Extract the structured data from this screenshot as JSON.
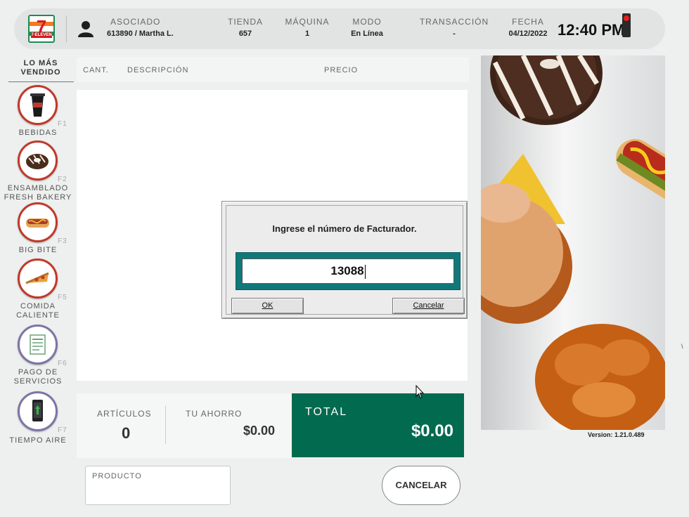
{
  "header": {
    "asociado_label": "ASOCIADO",
    "asociado_value": "613890 / Martha L.",
    "tienda_label": "TIENDA",
    "tienda_value": "657",
    "maquina_label": "MÁQUINA",
    "maquina_value": "1",
    "modo_label": "MODO",
    "modo_value": "En Línea",
    "transaccion_label": "TRANSACCIÓN",
    "transaccion_value": "-",
    "fecha_label": "FECHA",
    "fecha_value": "04/12/2022",
    "clock": "12:40 PM",
    "logo_text": "7-ELEVEN"
  },
  "sidebar": {
    "title": "LO MÁS VENDIDO",
    "items": [
      {
        "label": "BEBIDAS",
        "fkey": "F1",
        "icon": "drink-cup-icon"
      },
      {
        "label": "ENSAMBLADO FRESH BAKERY",
        "fkey": "F2",
        "icon": "donut-icon"
      },
      {
        "label": "BIG BITE",
        "fkey": "F3",
        "icon": "hotdog-icon"
      },
      {
        "label": "COMIDA CALIENTE",
        "fkey": "F5",
        "icon": "pizza-icon"
      },
      {
        "label": "PAGO DE SERVICIOS",
        "fkey": "F6",
        "icon": "receipt-icon"
      },
      {
        "label": "TIEMPO AIRE",
        "fkey": "F7",
        "icon": "smartphone-icon"
      }
    ]
  },
  "list": {
    "col_qty": "CANT.",
    "col_desc": "DESCRIPCIÓN",
    "col_price": "PRECIO"
  },
  "totals": {
    "articulos_label": "ARTÍCULOS",
    "articulos_value": "0",
    "ahorro_label": "TU AHORRO",
    "ahorro_value": "$0.00",
    "total_label": "TOTAL",
    "total_value": "$0.00"
  },
  "producto_label": "PRODUCTO",
  "cancel_button": "CANCELAR",
  "version": "Version: 1.21.0.489",
  "edge_mark": "\\",
  "dialog": {
    "message": "Ingrese el número de Facturador.",
    "input_value": "13088",
    "ok_label": "OK",
    "cancel_label": "Cancelar"
  },
  "colors": {
    "accent_green": "#016a4f",
    "dialog_frame": "#11787a",
    "category_ring": "#c0392b"
  }
}
